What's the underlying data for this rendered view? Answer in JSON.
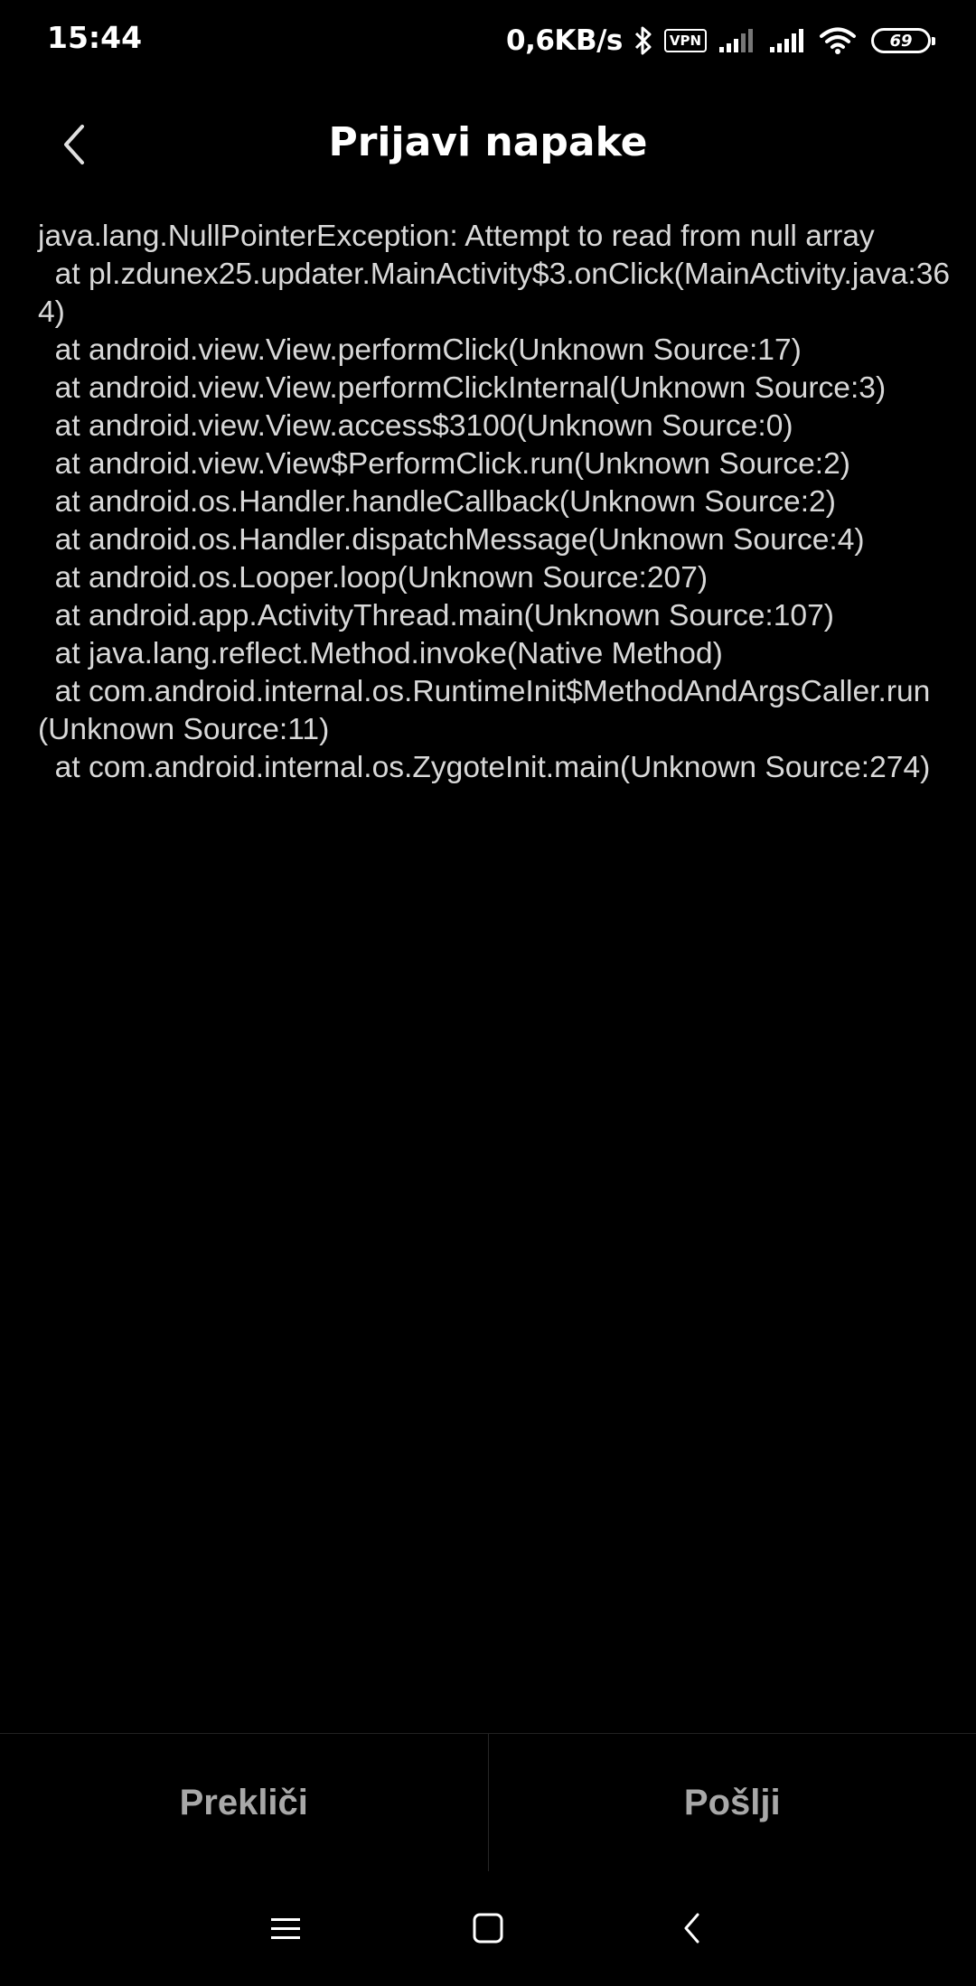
{
  "status_bar": {
    "time": "15:44",
    "net_speed": "0,6KB/s",
    "vpn_label": "VPN",
    "battery_level": "69",
    "icons": [
      "bluetooth-icon",
      "vpn-icon",
      "signal-icon",
      "signal-icon",
      "wifi-icon",
      "battery-icon"
    ]
  },
  "header": {
    "back_icon": "chevron-left-icon",
    "title": "Prijavi napake"
  },
  "trace": {
    "text": "java.lang.NullPointerException: Attempt to read from null array\n  at pl.zdunex25.updater.MainActivity$3.onClick(MainActivity.java:364)\n  at android.view.View.performClick(Unknown Source:17)\n  at android.view.View.performClickInternal(Unknown Source:3)\n  at android.view.View.access$3100(Unknown Source:0)\n  at android.view.View$PerformClick.run(Unknown Source:2)\n  at android.os.Handler.handleCallback(Unknown Source:2)\n  at android.os.Handler.dispatchMessage(Unknown Source:4)\n  at android.os.Looper.loop(Unknown Source:207)\n  at android.app.ActivityThread.main(Unknown Source:107)\n  at java.lang.reflect.Method.invoke(Native Method)\n  at com.android.internal.os.RuntimeInit$MethodAndArgsCaller.run(Unknown Source:11)\n  at com.android.internal.os.ZygoteInit.main(Unknown Source:274)"
  },
  "actions": {
    "cancel_label": "Prekliči",
    "send_label": "Pošlji"
  },
  "nav_bar": {
    "icons": [
      "menu-icon",
      "home-icon",
      "back-icon"
    ]
  },
  "colors": {
    "background": "#000000",
    "text": "#d8d8d8",
    "title": "#ffffff",
    "button_text": "#a8a8a8"
  }
}
